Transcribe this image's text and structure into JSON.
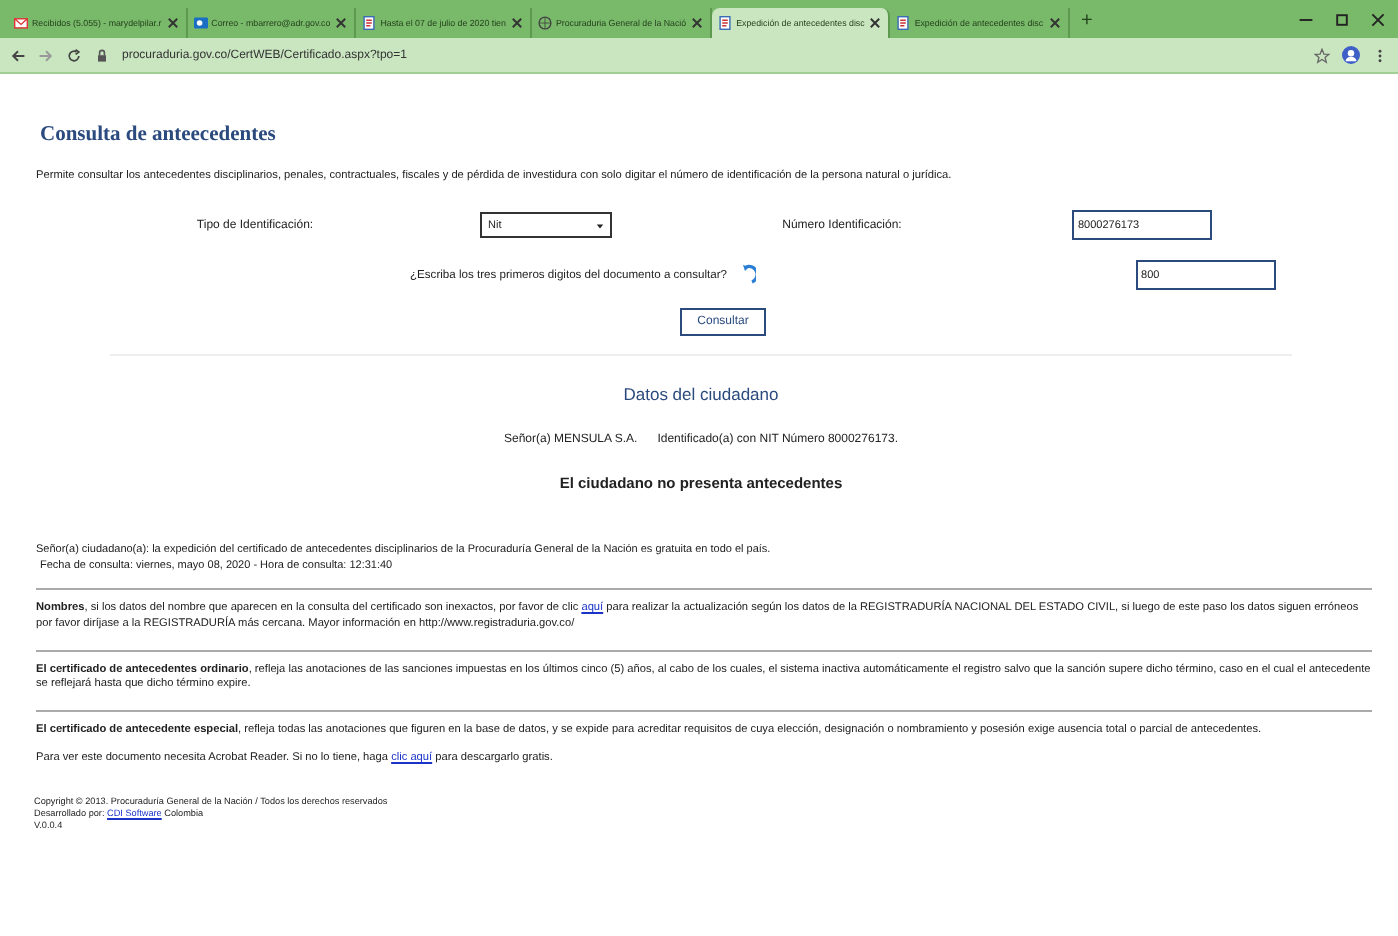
{
  "browser": {
    "tabs": [
      {
        "title": "Recibidos (5.055) - marydelpilar.r",
        "selected": false
      },
      {
        "title": "Correo - mbarrero@adr.gov.co",
        "selected": false
      },
      {
        "title": "Hasta el 07 de julio de 2020 tien",
        "selected": false
      },
      {
        "title": "Procuraduria General de la Nació",
        "selected": false
      },
      {
        "title": "Expedición de antecedentes disc",
        "selected": true
      },
      {
        "title": "Expedición de antecedentes disc",
        "selected": false
      }
    ],
    "new_tab": "+",
    "address": "procuraduria.gov.co/CertWEB/Certificado.aspx?tpo=1"
  },
  "page": {
    "title": "Consulta de anteecedentes",
    "intro": "Permite consultar los antecedentes disciplinarios, penales, contractuales, fiscales y de pérdida de investidura con solo digitar el número de identificación de la persona natural o jurídica.",
    "form": {
      "id_type_label": "Tipo de Identificación:",
      "id_type_value": "Nit",
      "id_number_label": "Número Identificación:",
      "id_number_value": "8000276173",
      "captcha_question": "¿Escriba los tres primeros digitos del documento a consultar?",
      "captcha_answer": "800",
      "submit": "Consultar"
    },
    "section_title": "Datos del ciudadano",
    "citizen": {
      "name_text": "Señor(a)  MENSULA S.A.",
      "id_text": "Identificado(a) con NIT Número 8000276173."
    },
    "result": "El ciudadano no presenta antecedentes",
    "notice": "Señor(a) ciudadano(a): la expedición del certificado de antecedentes disciplinarios de la Procuraduría General de la Nación es gratuita en todo el país.",
    "query_date": "Fecha de consulta: viernes, mayo 08, 2020 - Hora de consulta: 12:31:40",
    "info": [
      {
        "before": "**Nombres**, si los datos del nombre que aparecen en la consulta del certificado son inexactos, por favor de clic ",
        "link": "aquí",
        "after": " para realizar la actualización según los datos de la REGISTRADURÍA NACIONAL DEL ESTADO CIVIL, si luego de este paso los datos siguen erróneos por favor diríjase a la REGISTRADURÍA más cercana. Mayor información en http://www.registraduria.gov.co/"
      },
      {
        "before": "**El certificado de antecedentes ordinario**, refleja las anotaciones de las sanciones impuestas en los últimos cinco (5) años, al cabo de los cuales, el sistema inactiva automáticamente el registro salvo que la sanción supere dicho término, caso en el cual el antecedente se reflejará hasta que dicho término expire."
      },
      {
        "before": "**El certificado de antecedente especial**, refleja todas las anotaciones que figuren en la base de datos, y se expide para acreditar requisitos de cuya elección, designación o nombramiento y posesión exige ausencia total o parcial de antecedentes."
      },
      {
        "before": "Para ver este documento necesita Acrobat Reader. Si no lo tiene, haga ",
        "link": "clic aquí",
        "after": " para descargarlo gratis."
      }
    ],
    "footer": {
      "copyright": "Copyright © 2013. Procuraduría General de la Nación / Todos los derechos reservados",
      "developer_before": "Desarrollado por: ",
      "developer_link": "CDI Software",
      "developer_after": " Colombia",
      "version": "V.0.0.4"
    }
  }
}
